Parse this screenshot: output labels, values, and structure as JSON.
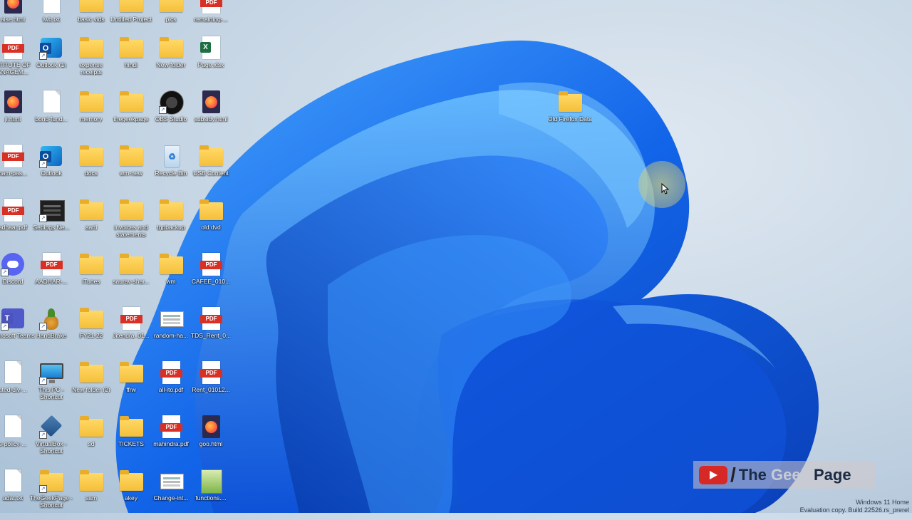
{
  "desktop": {
    "icons": [
      {
        "label": "aise.html",
        "type": "htmlf"
      },
      {
        "label": "lwb.txt",
        "type": "doc"
      },
      {
        "label": "basic vids",
        "type": "folder"
      },
      {
        "label": "Untitled Project",
        "type": "folder"
      },
      {
        "label": "pics",
        "type": "folder"
      },
      {
        "label": "remaining-...",
        "type": "pdf"
      },
      {
        "label": "STITUTE OF ANAGEM...",
        "type": "pdf"
      },
      {
        "label": "Outlook (1)",
        "type": "outlook"
      },
      {
        "label": "expense receipts",
        "type": "folder"
      },
      {
        "label": "hindi",
        "type": "folder"
      },
      {
        "label": "New folder",
        "type": "folder"
      },
      {
        "label": "Page.xlsx",
        "type": "xlsx"
      },
      {
        "label": "ji.html",
        "type": "htmlf"
      },
      {
        "label": "bond-fund...",
        "type": "doc"
      },
      {
        "label": "memory",
        "type": "folder"
      },
      {
        "label": "thegeekpage",
        "type": "folder"
      },
      {
        "label": "OBS Studio",
        "type": "obs"
      },
      {
        "label": "subsidy.html",
        "type": "htmlf"
      },
      {
        "label": "nam-pas...",
        "type": "pdf"
      },
      {
        "label": "Outlook",
        "type": "outlook"
      },
      {
        "label": "docs",
        "type": "folder"
      },
      {
        "label": "wm-new",
        "type": "folder"
      },
      {
        "label": "Recycle Bin",
        "type": "recycle"
      },
      {
        "label": "USB Content",
        "type": "folder"
      },
      {
        "label": "adhaar.pdf",
        "type": "pdf"
      },
      {
        "label": "Settings Ne...",
        "type": "settings"
      },
      {
        "label": "aarti",
        "type": "folder"
      },
      {
        "label": "invoices and statements",
        "type": "folder"
      },
      {
        "label": "tgpbackup",
        "type": "folder"
      },
      {
        "label": "old dvd",
        "type": "folder"
      },
      {
        "label": "Discord",
        "type": "discord"
      },
      {
        "label": "AADHAR-...",
        "type": "pdf"
      },
      {
        "label": "iTunes",
        "type": "folder"
      },
      {
        "label": "saurav-shar...",
        "type": "folder"
      },
      {
        "label": "wm",
        "type": "folder"
      },
      {
        "label": "CAFEE_010...",
        "type": "pdf"
      },
      {
        "label": "Microsoft Teams",
        "type": "teams"
      },
      {
        "label": "HandBrake",
        "type": "handbrake"
      },
      {
        "label": "FY21-22",
        "type": "folder"
      },
      {
        "label": "Jitendra_01...",
        "type": "pdf"
      },
      {
        "label": "random-ha...",
        "type": "imgfile"
      },
      {
        "label": "TDS_Rent_0...",
        "type": "pdf"
      },
      {
        "label": "ated-div-...",
        "type": "doc"
      },
      {
        "label": "This PC - Shortcut",
        "type": "thispc"
      },
      {
        "label": "New folder (2)",
        "type": "folder"
      },
      {
        "label": "ffrw",
        "type": "folder"
      },
      {
        "label": "all-ito.pdf",
        "type": "pdf"
      },
      {
        "label": "Rent_01012...",
        "type": "pdf"
      },
      {
        "label": "s-policy-...",
        "type": "doc"
      },
      {
        "label": "VirtualBox - Shortcut",
        "type": "vbox"
      },
      {
        "label": "sd",
        "type": "folder"
      },
      {
        "label": "TICKETS",
        "type": "folder"
      },
      {
        "label": "mahindra.pdf",
        "type": "pdf"
      },
      {
        "label": "goo.html",
        "type": "htmlf"
      },
      {
        "label": "adat.txt",
        "type": "doc"
      },
      {
        "label": "TheGeekPage - Shortcut",
        "type": "folder"
      },
      {
        "label": "sam",
        "type": "folder"
      },
      {
        "label": "akey",
        "type": "folder"
      },
      {
        "label": "Change-int...",
        "type": "imgfile"
      },
      {
        "label": "functions....",
        "type": "imgfile2"
      }
    ],
    "extra_icon": {
      "label": "Old Firefox Data",
      "type": "folder"
    }
  },
  "watermark": {
    "the": "The",
    "geek": "Geek",
    "page": "Page",
    "slash": "/"
  },
  "windows_watermark": {
    "line1": "Windows 11 Home",
    "line2": "Evaluation copy. Build 22526.rs_prerel"
  },
  "colors": {
    "accent": "#1a5fd8",
    "pdf_red": "#d93025",
    "folder_yellow": "#f5bf3a"
  }
}
